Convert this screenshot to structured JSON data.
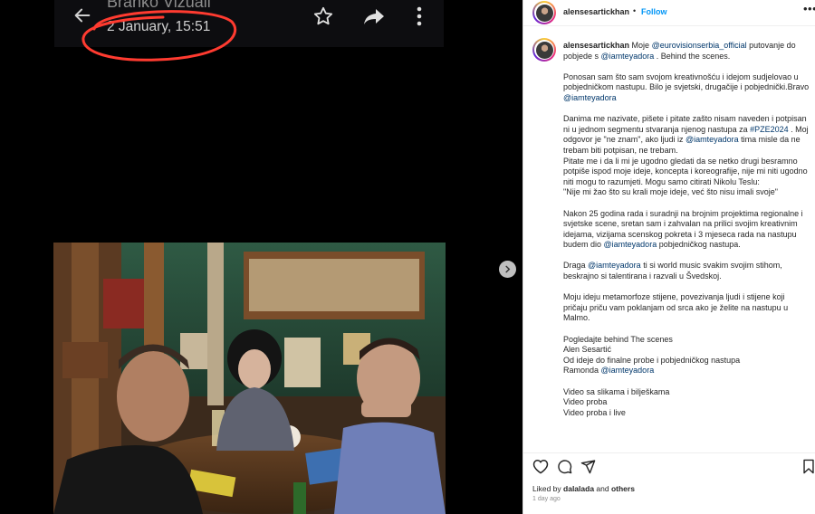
{
  "media": {
    "contact_name": "Branko Vizuali",
    "timestamp": "2 January, 15:51",
    "annotation_color": "#ff3b30"
  },
  "post": {
    "username": "alensesartickhan",
    "follow_label": "Follow",
    "caption": {
      "p1_text_a": " Moje ",
      "p1_mention_a": "@eurovisionserbia_official",
      "p1_text_b": " putovanje do pobjede s ",
      "p1_mention_b": "@iamteyadora",
      "p1_text_c": " . Behind the scenes.",
      "p2": "Ponosan sam što sam svojom kreativnošću i idejom sudjelovao u pobjedničkom nastupu. Bilo je svjetski, drugačije i pobjednički.Bravo ",
      "p2_mention": "@iamteyadora",
      "p3_text_a": "Danima me nazivate, pišete i pitate zašto nisam naveden i potpisan ni u jednom segmentu stvaranja njenog nastupa za ",
      "p3_hashtag": "#PZE2024",
      "p3_text_b": " . Moj odgovor je \"ne znam\", ako ljudi iz ",
      "p3_mention": "@iamteyadora",
      "p3_text_c": " tima misle da ne trebam biti potpisan, ne trebam.",
      "p3_line2": "Pitate me i da li mi je ugodno gledati da se netko drugi besramno potpiše ispod moje ideje, koncepta i koreografije, nije mi niti ugodno niti mogu to razumjeti. Mogu samo citirati Nikolu Teslu:",
      "p3_quote": "\"Nije mi žao što su krali moje ideje, već što nisu imali svoje\"",
      "p4_text_a": "Nakon 25 godina rada i suradnji na brojnim projektima regionalne i svjetske scene, sretan sam i zahvalan na prilici svojim kreativnim idejama, vizijama scenskog pokreta i 3 mjeseca rada na nastupu budem dio ",
      "p4_mention": "@iamteyadora",
      "p4_text_b": " pobjedničkog nastupa.",
      "p5_text_a": "Draga ",
      "p5_mention": "@iamteyadora",
      "p5_text_b": " ti si world music svakim svojim stihom, beskrajno si talentirana i razvali u Švedskoj.",
      "p6": "Moju ideju metamorfoze stijene, povezivanja ljudi i stijene koji pričaju priču vam poklanjam od srca ako je želite na nastupu u Malmo.",
      "p7_l1": "Pogledajte behind The scenes",
      "p7_l2": "Alen Sesartić",
      "p7_l3": "Od ideje do finalne probe i pobjedničkog nastupa",
      "p7_l4_text": "Ramonda ",
      "p7_l4_mention": "@iamteyadora",
      "p8_l1": "Video sa slikama i bilješkama",
      "p8_l2": "Video proba",
      "p8_l3": "Video proba i live"
    },
    "likes": {
      "prefix": "Liked by ",
      "user": "dalalada",
      "middle": " and ",
      "others": "others"
    },
    "age": "1 day ago",
    "colors": {
      "link": "#00376b",
      "follow": "#0095f6"
    }
  }
}
